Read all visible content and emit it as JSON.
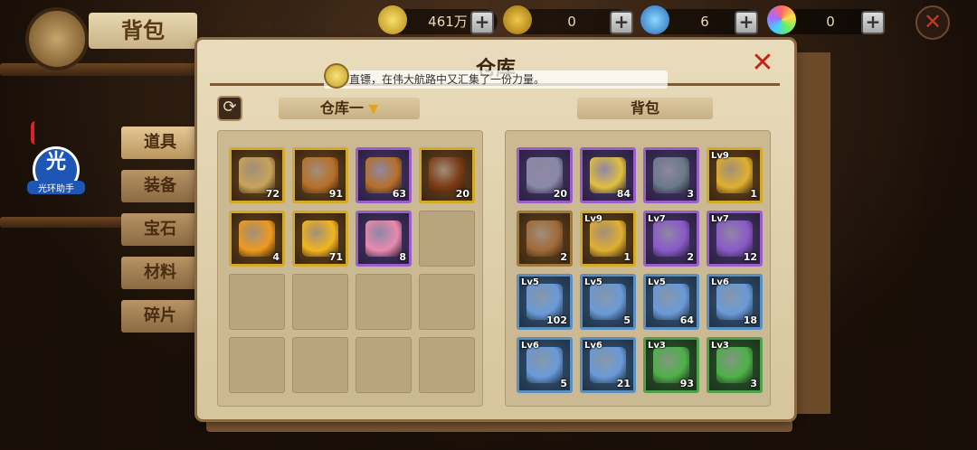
{
  "resources": [
    {
      "icon": "gold-ingot-icon",
      "value": "461万"
    },
    {
      "icon": "coin-icon",
      "value": "0"
    },
    {
      "icon": "diamond-icon",
      "value": "6"
    },
    {
      "icon": "rainbow-gem-icon",
      "value": "0"
    }
  ],
  "header": {
    "title": "背包"
  },
  "sidebar": {
    "tabs": [
      "道具",
      "装备",
      "宝石",
      "材料",
      "碎片"
    ]
  },
  "helper": {
    "glyph": "光",
    "label": "光环助手"
  },
  "panel": {
    "title": "仓库",
    "ticker": "直镖，在伟大航路中又汇集了一份力量。",
    "warehouse_label": "仓库一",
    "bag_label": "背包"
  },
  "warehouse": [
    {
      "rarity": "gold",
      "icon": "map-scroll-icon",
      "color": "#c9a35a",
      "count": "72"
    },
    {
      "rarity": "gold",
      "icon": "bronze-medal-icon",
      "color": "#b8702a",
      "count": "91"
    },
    {
      "rarity": "purple",
      "icon": "bronze-medal-icon",
      "color": "#b8702a",
      "count": "63"
    },
    {
      "rarity": "gold",
      "icon": "fire-rune-icon",
      "color": "#7a3a14",
      "count": "20"
    },
    {
      "rarity": "gold",
      "icon": "amber-crystal-icon",
      "color": "#f09a20",
      "count": "4"
    },
    {
      "rarity": "gold",
      "icon": "gold-gem-icon",
      "color": "#f3b620",
      "count": "71"
    },
    {
      "rarity": "purple",
      "icon": "character-shard-icon",
      "color": "#e88ab0",
      "count": "8"
    }
  ],
  "bag": [
    {
      "rarity": "purple",
      "icon": "spiked-helmet-icon",
      "color": "#8a8aa8",
      "lv": "",
      "count": "20"
    },
    {
      "rarity": "purple",
      "icon": "snail-icon",
      "color": "#e0c040",
      "lv": "",
      "count": "84"
    },
    {
      "rarity": "purple",
      "icon": "ore-icon",
      "color": "#6a7a8a",
      "lv": "",
      "count": "3"
    },
    {
      "rarity": "gold",
      "icon": "gold-book-icon",
      "color": "#e0b030",
      "lv": "Lv9",
      "count": "1"
    },
    {
      "rarity": "brown",
      "icon": "antler-headband-icon",
      "color": "#a06a3a",
      "lv": "",
      "count": "2"
    },
    {
      "rarity": "gold",
      "icon": "gold-book-icon",
      "color": "#e0b030",
      "lv": "Lv9",
      "count": "1"
    },
    {
      "rarity": "purple",
      "icon": "purple-book-icon",
      "color": "#8a5ac8",
      "lv": "Lv7",
      "count": "2"
    },
    {
      "rarity": "purple",
      "icon": "purple-book-icon",
      "color": "#8a5ac8",
      "lv": "Lv7",
      "count": "12"
    },
    {
      "rarity": "blue",
      "icon": "blue-book-icon",
      "color": "#6a9ad8",
      "lv": "Lv5",
      "count": "102"
    },
    {
      "rarity": "blue",
      "icon": "blue-book-icon",
      "color": "#6a9ad8",
      "lv": "Lv5",
      "count": "5"
    },
    {
      "rarity": "blue",
      "icon": "blue-book-icon",
      "color": "#6a9ad8",
      "lv": "Lv5",
      "count": "64"
    },
    {
      "rarity": "blue",
      "icon": "blue-book-icon",
      "color": "#6a9ad8",
      "lv": "Lv6",
      "count": "18"
    },
    {
      "rarity": "blue",
      "icon": "blue-book-icon",
      "color": "#6a9ad8",
      "lv": "Lv6",
      "count": "5"
    },
    {
      "rarity": "blue",
      "icon": "blue-book-icon",
      "color": "#6a9ad8",
      "lv": "Lv6",
      "count": "21"
    },
    {
      "rarity": "green",
      "icon": "green-book-icon",
      "color": "#4fb04a",
      "lv": "Lv3",
      "count": "93"
    },
    {
      "rarity": "green",
      "icon": "green-book-icon",
      "color": "#4fb04a",
      "lv": "Lv3",
      "count": "3"
    }
  ]
}
